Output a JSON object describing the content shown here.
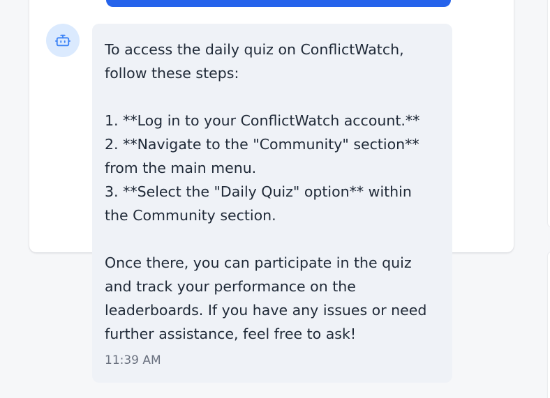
{
  "message": {
    "intro": "To access the daily quiz on ConflictWatch, follow these steps:",
    "steps": [
      "1. **Log in to your ConflictWatch account.**",
      "2. **Navigate to the \"Community\" section** from the main menu.",
      "3. **Select the \"Daily Quiz\" option** within the Community section."
    ],
    "outro": "Once there, you can participate in the quiz and track your performance on the leaderboards. If you have any issues or need further assistance, feel free to ask!",
    "timestamp": "11:39 AM"
  },
  "avatar": {
    "icon": "bot-icon"
  },
  "colors": {
    "accent": "#2563eb",
    "bubble": "#eff2f7",
    "avatar_bg": "#dbeafe",
    "icon": "#3b82f6"
  }
}
